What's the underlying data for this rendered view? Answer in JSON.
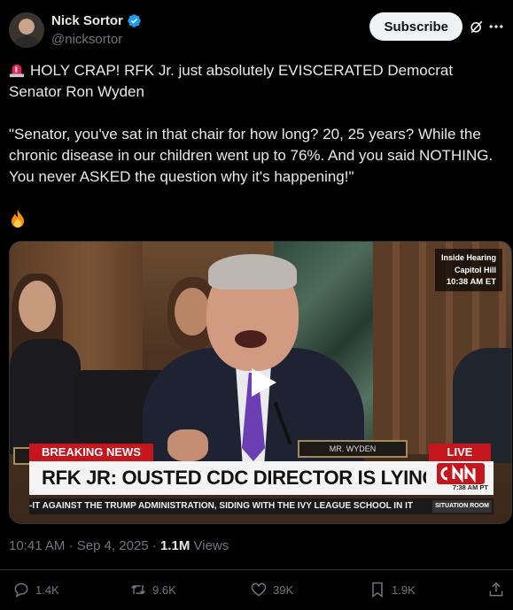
{
  "author": {
    "name": "Nick Sortor",
    "handle": "@nicksortor",
    "verified": true
  },
  "header": {
    "subscribe_label": "Subscribe",
    "icons": [
      "grok-icon",
      "more-icon"
    ]
  },
  "post": {
    "line1": "HOLY CRAP! RFK Jr. just absolutely EVISCERATED Democrat Senator Ron Wyden",
    "quote": "\"Senator, you've sat in that chair for how long? 20, 25 years? While the chronic disease in our children went up to 76%. And you said NOTHING. You never ASKED the question why it's happening!\"",
    "emoji_siren": "siren-icon",
    "emoji_fire": "fire-icon"
  },
  "video": {
    "bug_line1": "Inside Hearing",
    "bug_line2": "Capitol Hill",
    "bug_time": "10:38 AM ET",
    "breaking": "BREAKING NEWS",
    "live": "LIVE",
    "headline": "RFK JR: OUSTED CDC DIRECTOR IS LYING",
    "cnn_time": "7:38 AM PT",
    "ticker": "-IT AGAINST THE TRUMP ADMINISTRATION, SIDING WITH THE IVY LEAGUE SCHOOL IN IT",
    "situation_room": "SITUATION ROOM",
    "nameplate": "MR. WYDEN"
  },
  "meta": {
    "time": "10:41 AM",
    "sep1": " · ",
    "date": "Sep 4, 2025",
    "sep2": " · ",
    "views": "1.1M",
    "views_label": " Views"
  },
  "actions": {
    "replies": "1.4K",
    "reposts": "9.6K",
    "likes": "39K",
    "bookmarks": "1.9K"
  },
  "colors": {
    "background": "#000000",
    "text": "#e7e9ea",
    "muted": "#71767b",
    "verified": "#1d9bf0",
    "cnn_red": "#c4161c"
  }
}
